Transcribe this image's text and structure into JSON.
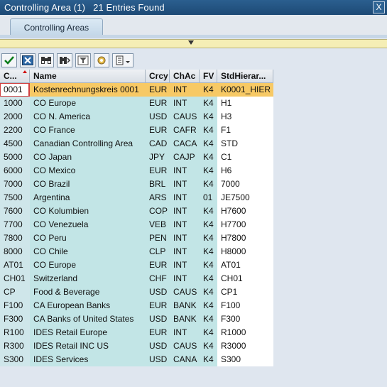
{
  "window": {
    "title": "Controlling Area (1)   21 Entries Found",
    "close_label": "X"
  },
  "tabs": [
    {
      "label": "Controlling Areas"
    }
  ],
  "toolbar": {
    "icons": [
      "check-icon",
      "close-icon",
      "find-icon",
      "find-next-icon",
      "filter-icon",
      "settings-icon",
      "print-icon"
    ]
  },
  "table": {
    "columns": [
      "C...",
      "Name",
      "Crcy",
      "ChAc",
      "FV",
      "StdHierar..."
    ],
    "rows": [
      [
        "0001",
        "Kostenrechnungskreis 0001",
        "EUR",
        "INT",
        "K4",
        "K0001_HIER"
      ],
      [
        "1000",
        "CO Europe",
        "EUR",
        "INT",
        "K4",
        "H1"
      ],
      [
        "2000",
        "CO N. America",
        "USD",
        "CAUS",
        "K4",
        "H3"
      ],
      [
        "2200",
        "CO France",
        "EUR",
        "CAFR",
        "K4",
        "F1"
      ],
      [
        "4500",
        "Canadian Controlling Area",
        "CAD",
        "CACA",
        "K4",
        "STD"
      ],
      [
        "5000",
        "CO Japan",
        "JPY",
        "CAJP",
        "K4",
        "C1"
      ],
      [
        "6000",
        "CO Mexico",
        "EUR",
        "INT",
        "K4",
        "H6"
      ],
      [
        "7000",
        "CO Brazil",
        "BRL",
        "INT",
        "K4",
        "7000"
      ],
      [
        "7500",
        "Argentina",
        "ARS",
        "INT",
        "01",
        "JE7500"
      ],
      [
        "7600",
        "CO Kolumbien",
        "COP",
        "INT",
        "K4",
        "H7600"
      ],
      [
        "7700",
        "CO Venezuela",
        "VEB",
        "INT",
        "K4",
        "H7700"
      ],
      [
        "7800",
        "CO Peru",
        "PEN",
        "INT",
        "K4",
        "H7800"
      ],
      [
        "8000",
        "CO Chile",
        "CLP",
        "INT",
        "K4",
        "H8000"
      ],
      [
        "AT01",
        "CO Europe",
        "EUR",
        "INT",
        "K4",
        "AT01"
      ],
      [
        "CH01",
        "Switzerland",
        "CHF",
        "INT",
        "K4",
        "CH01"
      ],
      [
        "CP",
        "Food & Beverage",
        "USD",
        "CAUS",
        "K4",
        "CP1"
      ],
      [
        "F100",
        "CA European Banks",
        "EUR",
        "BANK",
        "K4",
        "F100"
      ],
      [
        "F300",
        "CA Banks of United States",
        "USD",
        "BANK",
        "K4",
        "F300"
      ],
      [
        "R100",
        "IDES Retail Europe",
        "EUR",
        "INT",
        "K4",
        "R1000"
      ],
      [
        "R300",
        "IDES Retail INC US",
        "USD",
        "CAUS",
        "K4",
        "R3000"
      ],
      [
        "S300",
        "IDES Services",
        "USD",
        "CANA",
        "K4",
        "S300"
      ]
    ],
    "selected_row": 0
  }
}
